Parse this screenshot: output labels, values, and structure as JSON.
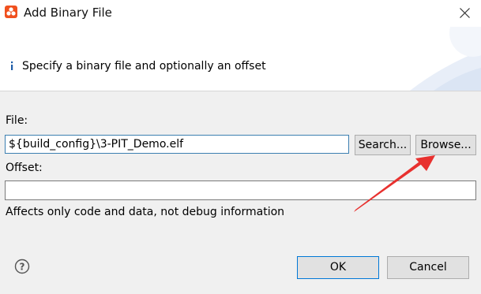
{
  "window": {
    "title": "Add Binary File",
    "icon": "app-icon"
  },
  "header": {
    "message": "Specify a binary file and optionally an offset",
    "icon": "info-icon"
  },
  "form": {
    "file_label": "File:",
    "file_value": "${build_config}\\3-PIT_Demo.elf",
    "search_label": "Search...",
    "browse_label": "Browse...",
    "offset_label": "Offset:",
    "offset_value": "",
    "hint": "Affects only code and data, not debug information"
  },
  "footer": {
    "ok_label": "OK",
    "cancel_label": "Cancel",
    "help_icon": "help-icon"
  },
  "colors": {
    "accent": "#0078d7",
    "annotation_arrow": "#e8312f",
    "app_icon": "#f0501e"
  }
}
